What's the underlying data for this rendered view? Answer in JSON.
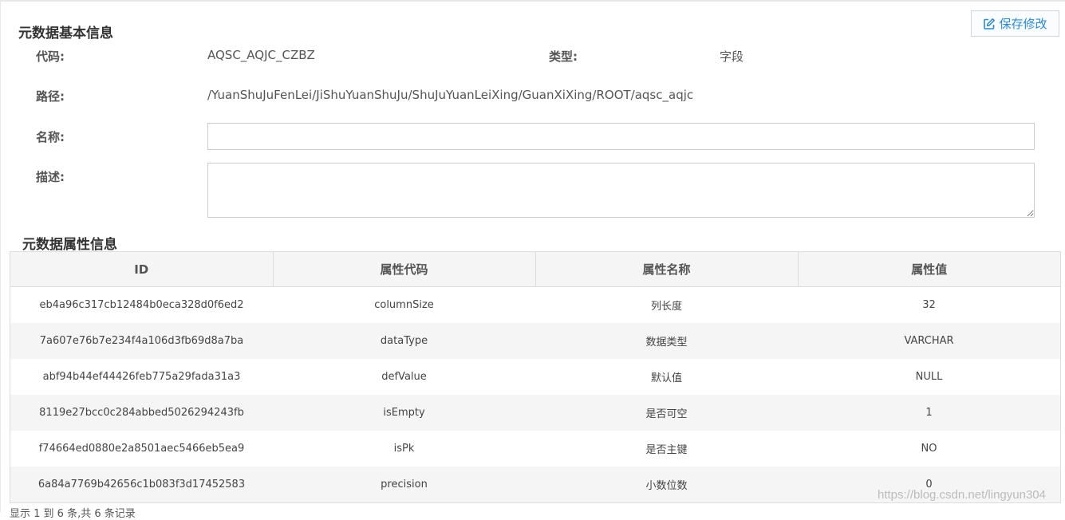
{
  "basic_info": {
    "section_title": "元数据基本信息",
    "save_button_label": "保存修改",
    "save_icon": "edit-icon",
    "code_label": "代码:",
    "code_value": "AQSC_AQJC_CZBZ",
    "type_label": "类型:",
    "type_value": "字段",
    "path_label": "路径:",
    "path_value": "/YuanShuJuFenLei/JiShuYuanShuJu/ShuJuYuanLeiXing/GuanXiXing/ROOT/aqsc_aqjc",
    "name_label": "名称:",
    "name_value": "",
    "desc_label": "描述:",
    "desc_value": ""
  },
  "attributes": {
    "section_title": "元数据属性信息",
    "columns": [
      "ID",
      "属性代码",
      "属性名称",
      "属性值"
    ],
    "rows": [
      [
        "eb4a96c317cb12484b0eca328d0f6ed2",
        "columnSize",
        "列长度",
        "32"
      ],
      [
        "7a607e76b7e234f4a106d3fb69d8a7ba",
        "dataType",
        "数据类型",
        "VARCHAR"
      ],
      [
        "abf94b44ef44426feb775a29fada31a3",
        "defValue",
        "默认值",
        "NULL"
      ],
      [
        "8119e27bcc0c284abbed5026294243fb",
        "isEmpty",
        "是否可空",
        "1"
      ],
      [
        "f74664ed0880e2a8501aec5466eb5ea9",
        "isPk",
        "是否主键",
        "NO"
      ],
      [
        "6a84a7769b42656c1b083f3d17452583",
        "precision",
        "小数位数",
        "0"
      ]
    ]
  },
  "footer": {
    "text": "显示 1 到 6 条,共 6 条记录"
  },
  "watermark": "https://blog.csdn.net/lingyun304",
  "colors": {
    "accent": "#2a8ad8",
    "header_bg": "#f5f5f5",
    "border": "#dddddd"
  }
}
